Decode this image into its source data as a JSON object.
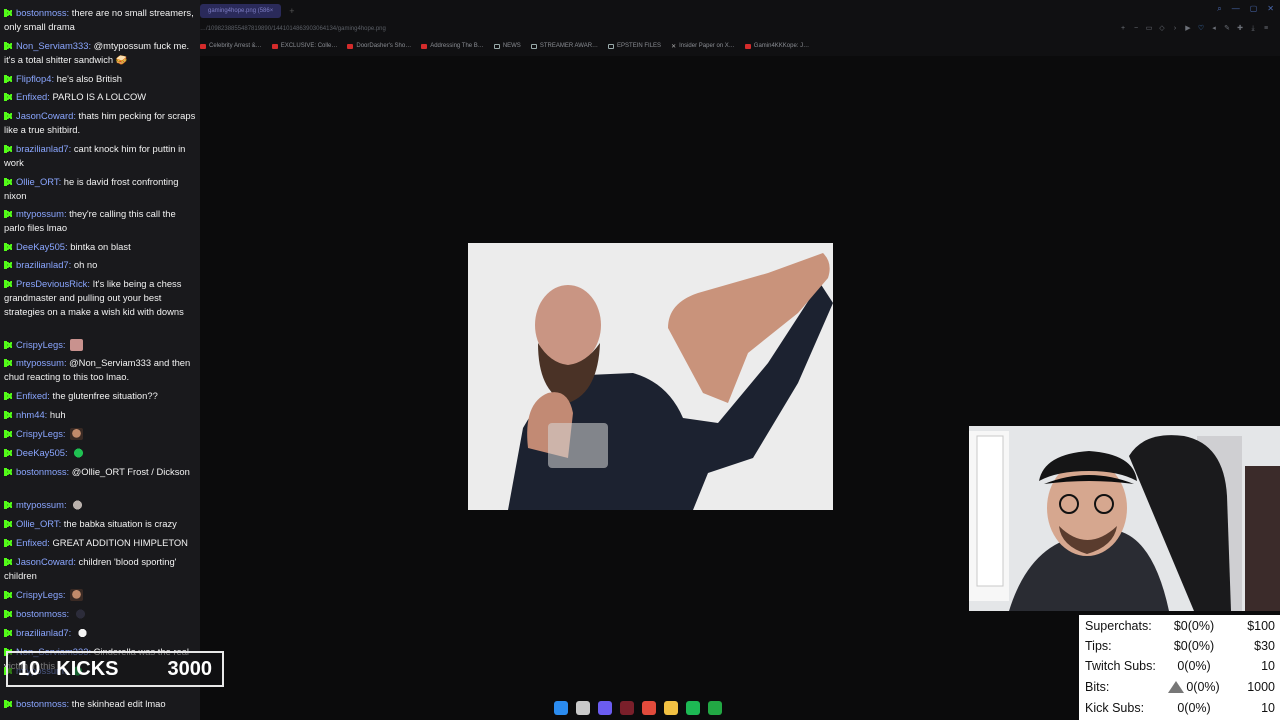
{
  "browser": {
    "tabs": [
      {
        "label": "gaming4hope.png (586×"
      }
    ],
    "new_tab": "+",
    "url": "…/1098238855487819890/1441014863903064134/gaming4hope.png",
    "bookmarks": [
      {
        "label": "Celebrity Arrest &…",
        "kind": "yt"
      },
      {
        "label": "EXCLUSIVE: Colle…",
        "kind": "yt"
      },
      {
        "label": "DoorDasher's Sho…",
        "kind": "yt"
      },
      {
        "label": "Addressing The B…",
        "kind": "yt"
      },
      {
        "label": "NEWS",
        "kind": "folder"
      },
      {
        "label": "STREAMER AWAR…",
        "kind": "folder"
      },
      {
        "label": "EPSTEIN FILES",
        "kind": "folder"
      },
      {
        "label": "Insider Paper on X…",
        "kind": "x"
      },
      {
        "label": "Gamin4KKKope: J…",
        "kind": "yt"
      }
    ],
    "toolbar_icons": [
      "zoom-in-icon",
      "zoom-out-icon",
      "tab-icon",
      "bookmark-icon",
      "forward-icon",
      "play-icon",
      "heart-icon",
      "speaker-icon",
      "brush-icon",
      "puzzle-icon",
      "download-icon",
      "menu-icon"
    ],
    "window_controls": [
      "search-icon",
      "minimize-icon",
      "restore-icon",
      "close-icon"
    ]
  },
  "chat": {
    "messages": [
      {
        "user": "bostonmoss",
        "text": "there are no small streamers, only small drama",
        "emote": ""
      },
      {
        "user": "Non_Serviam333",
        "text": "@mtypossum fuck me. it's a total shitter sandwich 🥪",
        "emote": ""
      },
      {
        "user": "Flipflop4",
        "text": "he's also British",
        "emote": ""
      },
      {
        "user": "Enfixed",
        "text": "PARLO IS A LOLCOW",
        "emote": ""
      },
      {
        "user": "JasonCoward",
        "text": "thats him pecking for scraps like a true shitbird.",
        "emote": ""
      },
      {
        "user": "brazilianlad7",
        "text": "cant knock him for puttin in work",
        "emote": ""
      },
      {
        "user": "Ollie_ORT",
        "text": "he is david frost confronting nixon",
        "emote": ""
      },
      {
        "user": "mtypossum",
        "text": "they're calling this call the parlo files lmao",
        "emote": ""
      },
      {
        "user": "DeeKay505",
        "text": "bintka on blast",
        "emote": ""
      },
      {
        "user": "brazilianlad7",
        "text": "oh no",
        "emote": ""
      },
      {
        "user": "PresDeviousRick",
        "text": "It's like being a chess grandmaster and pulling out your best strategies on a make a wish kid with downs",
        "emote": ""
      },
      {
        "user": "CrispyLegs",
        "text": "",
        "emote": "pink"
      },
      {
        "user": "mtypossum",
        "text": "@Non_Serviam333 and then chud reacting to this too lmao.",
        "emote": ""
      },
      {
        "user": "Enfixed",
        "text": "the glutenfree situation??",
        "emote": ""
      },
      {
        "user": "nhm44",
        "text": "huh",
        "emote": ""
      },
      {
        "user": "CrispyLegs",
        "text": "",
        "emote": "face"
      },
      {
        "user": "DeeKay505",
        "text": "",
        "emote": "green"
      },
      {
        "user": "bostonmoss",
        "text": "@Ollie_ORT Frost / Dickson",
        "emote": ""
      },
      {
        "user": "mtypossum",
        "text": "",
        "emote": "gray"
      },
      {
        "user": "Ollie_ORT",
        "text": "the babka situation is crazy",
        "emote": ""
      },
      {
        "user": "Enfixed",
        "text": "GREAT ADDITION HIMPLETON",
        "emote": ""
      },
      {
        "user": "JasonCoward",
        "text": "children 'blood sporting' children",
        "emote": ""
      },
      {
        "user": "CrispyLegs",
        "text": "",
        "emote": "face"
      },
      {
        "user": "bostonmoss",
        "text": "",
        "emote": "dark"
      },
      {
        "user": "brazilianlad7",
        "text": "",
        "emote": "white"
      },
      {
        "user": "Non_Serviam333",
        "text": "Cinderella was the real victim in this",
        "emote": ""
      },
      {
        "user": "mtypossum",
        "text": "",
        "emote": "green"
      },
      {
        "user": "bostonmoss",
        "text": "the skinhead edit lmao",
        "emote": ""
      }
    ]
  },
  "kicks_goal": {
    "current": "10",
    "label": "KICKS",
    "target": "3000"
  },
  "stats": {
    "rows": [
      {
        "label": "Superchats:",
        "value": "$0(0%)",
        "goal": "$100",
        "icon": ""
      },
      {
        "label": "Tips:",
        "value": "$0(0%)",
        "goal": "$30",
        "icon": ""
      },
      {
        "label": "Twitch Subs:",
        "value": "0(0%)",
        "goal": "10",
        "icon": ""
      },
      {
        "label": "Bits:",
        "value": "0(0%)",
        "goal": "1000",
        "icon": "bits-icon"
      },
      {
        "label": "Kick Subs:",
        "value": "0(0%)",
        "goal": "10",
        "icon": ""
      }
    ]
  },
  "taskbar": {
    "icons": [
      {
        "name": "windows-start-icon",
        "color": "#2b8cf0"
      },
      {
        "name": "search-icon",
        "color": "#c9c9c9"
      },
      {
        "name": "discord-icon",
        "color": "#6b5cf0"
      },
      {
        "name": "obs-icon",
        "color": "#7a1f2a"
      },
      {
        "name": "chrome-icon",
        "color": "#e24b3c"
      },
      {
        "name": "folder-icon",
        "color": "#f2c143"
      },
      {
        "name": "spotify-icon",
        "color": "#1db954"
      },
      {
        "name": "xbox-icon",
        "color": "#22a844"
      }
    ]
  },
  "colors": {
    "kick_green": "#53fc18",
    "username_blue": "#8aa6ff",
    "chat_bg": "#19191c",
    "page_bg": "#0b0b0c"
  }
}
